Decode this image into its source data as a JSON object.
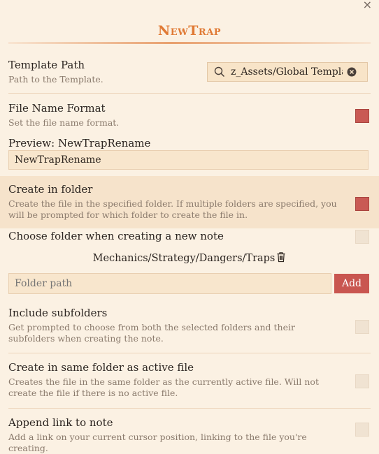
{
  "modal": {
    "title": "NewTrap",
    "close_label": "×"
  },
  "settings": {
    "template_path": {
      "name": "Template Path",
      "desc": "Path to the Template.",
      "value": "z_Assets/Global Templates/",
      "search_icon": "search-icon",
      "clear_icon": "clear-icon"
    },
    "file_name_format": {
      "name": "File Name Format",
      "desc": "Set the file name format.",
      "enabled": true,
      "preview_label": "Preview: NewTrapRename",
      "value": "NewTrapRename"
    },
    "create_in_folder": {
      "name": "Create in folder",
      "desc": "Create the file in the specified folder. If multiple folders are specified, you will be prompted for which folder to create the file in.",
      "enabled": true
    },
    "choose_folder": {
      "name": "Choose folder when creating a new note",
      "enabled": false
    },
    "folders": [
      "Mechanics/Strategy/Dangers/Traps"
    ],
    "folder_path": {
      "placeholder": "Folder path",
      "add_label": "Add"
    },
    "include_subfolders": {
      "name": "Include subfolders",
      "desc": "Get prompted to choose from both the selected folders and their subfolders when creating the note.",
      "enabled": false
    },
    "same_folder": {
      "name": "Create in same folder as active file",
      "desc": "Creates the file in the same folder as the currently active file. Will not create the file if there is no active file.",
      "enabled": false
    },
    "append_link": {
      "name": "Append link to note",
      "desc": "Add a link on your current cursor position, linking to the file you're creating.",
      "enabled": false
    }
  },
  "colors": {
    "accent": "#e07a35",
    "toggle_on": "#c95a54",
    "background": "#fbf1e3"
  }
}
